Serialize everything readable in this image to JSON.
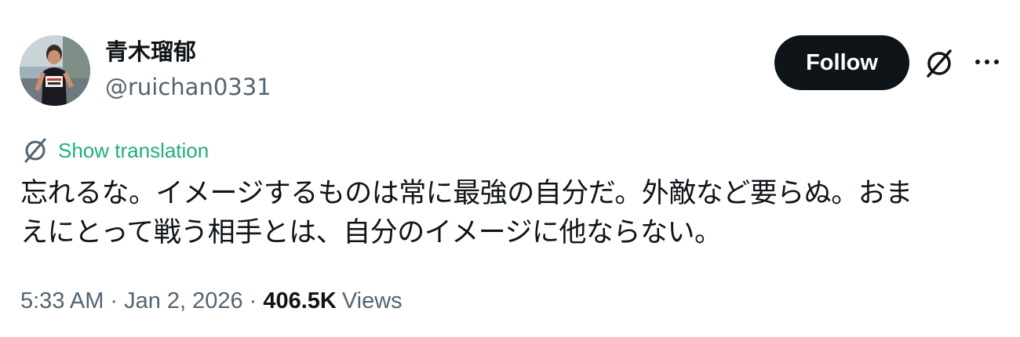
{
  "author": {
    "display_name": "青木瑠郁",
    "handle": "@ruichan0331"
  },
  "actions": {
    "follow_label": "Follow",
    "grok_icon": "grok-icon",
    "more_icon": "more-icon"
  },
  "translation": {
    "label": "Show translation",
    "icon": "translate-icon",
    "color": "#1fb07a"
  },
  "tweet": {
    "lines": [
      "忘れるな。イメージするものは常に最強の自分だ。外敵など要らぬ。おま",
      "えにとって戦う相手とは、自分のイメージに他ならない。"
    ]
  },
  "meta": {
    "time": "5:33 AM",
    "separator": "·",
    "date": "Jan 2, 2026",
    "views_count": "406.5K",
    "views_label": "Views"
  },
  "colors": {
    "text_primary": "#0f1419",
    "text_secondary": "#536471",
    "follow_bg": "#0f1419"
  }
}
